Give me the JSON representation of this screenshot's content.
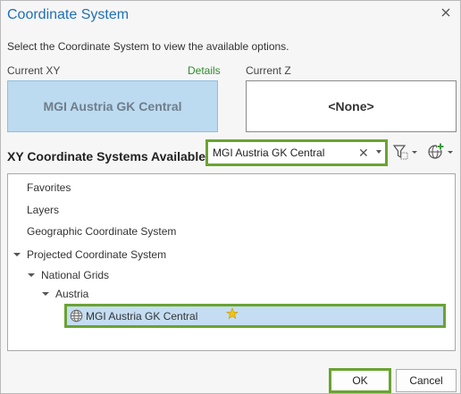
{
  "dialog": {
    "title": "Coordinate System",
    "close_icon": "close-icon",
    "instruction": "Select the Coordinate System to view the available options."
  },
  "current": {
    "xy_label": "Current XY",
    "details_link": "Details",
    "xy_value": "MGI Austria GK Central",
    "z_label": "Current Z",
    "z_value": "<None>"
  },
  "available": {
    "heading": "XY Coordinate Systems Available",
    "search_value": "MGI Austria GK Central",
    "clear_icon": "clear-x-icon",
    "filter_icon": "filter-icon",
    "add_icon": "globe-add-icon"
  },
  "tree": {
    "items": [
      {
        "label": "Favorites",
        "expanded": false,
        "selected": false
      },
      {
        "label": "Layers",
        "expanded": false,
        "selected": false
      },
      {
        "label": "Geographic Coordinate System",
        "expanded": false,
        "selected": false
      },
      {
        "label": "Projected Coordinate System",
        "expanded": true,
        "selected": false
      },
      {
        "label": "National Grids",
        "expanded": true,
        "selected": false
      },
      {
        "label": "Austria",
        "expanded": true,
        "selected": false
      },
      {
        "label": "MGI Austria GK Central",
        "expanded": false,
        "selected": true,
        "icon": "globe-icon",
        "badge_icon": "favorite-star-icon"
      }
    ]
  },
  "buttons": {
    "ok": "OK",
    "cancel": "Cancel"
  },
  "colors": {
    "title": "#1f6fb5",
    "highlight_border": "#6aa332",
    "selection_fill": "#c4ddf2",
    "current_xy_fill": "#bcdaf0",
    "details_link": "#2e8b2e"
  }
}
